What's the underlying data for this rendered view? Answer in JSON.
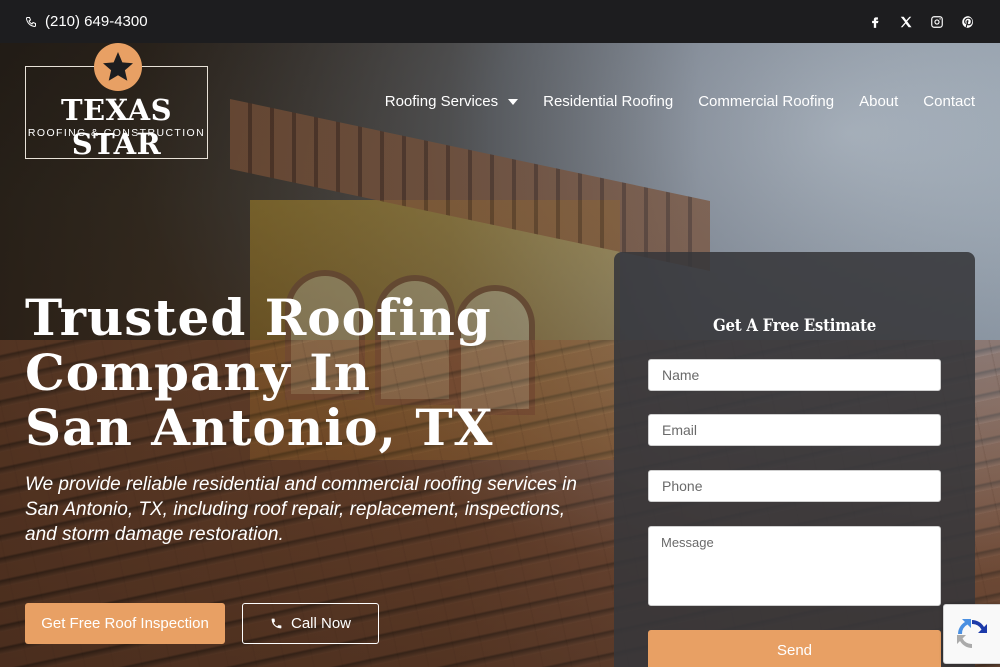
{
  "topbar": {
    "phone": "(210) 649-4300",
    "socials": [
      "facebook-icon",
      "x-icon",
      "instagram-icon",
      "pinterest-icon"
    ]
  },
  "logo": {
    "main": "TEXAS STAR",
    "sub": "ROOFING & CONSTRUCTION"
  },
  "nav": {
    "items": [
      {
        "label": "Roofing Services",
        "has_dropdown": true
      },
      {
        "label": "Residential Roofing"
      },
      {
        "label": "Commercial Roofing"
      },
      {
        "label": "About"
      },
      {
        "label": "Contact"
      }
    ]
  },
  "hero": {
    "title": "Trusted Roofing Company In San Antonio, TX",
    "subtitle": "We provide reliable residential and commercial roofing services in San Antonio, TX, including roof repair, replacement, inspections, and storm damage restoration.",
    "primary_cta": "Get Free Roof Inspection",
    "secondary_cta": "Call Now"
  },
  "form": {
    "title": "Get A Free Estimate",
    "name_placeholder": "Name",
    "email_placeholder": "Email",
    "phone_placeholder": "Phone",
    "message_placeholder": "Message",
    "submit_label": "Send"
  },
  "colors": {
    "accent": "#e8a064",
    "topbar": "#1d1d1f",
    "card": "#37373a"
  }
}
